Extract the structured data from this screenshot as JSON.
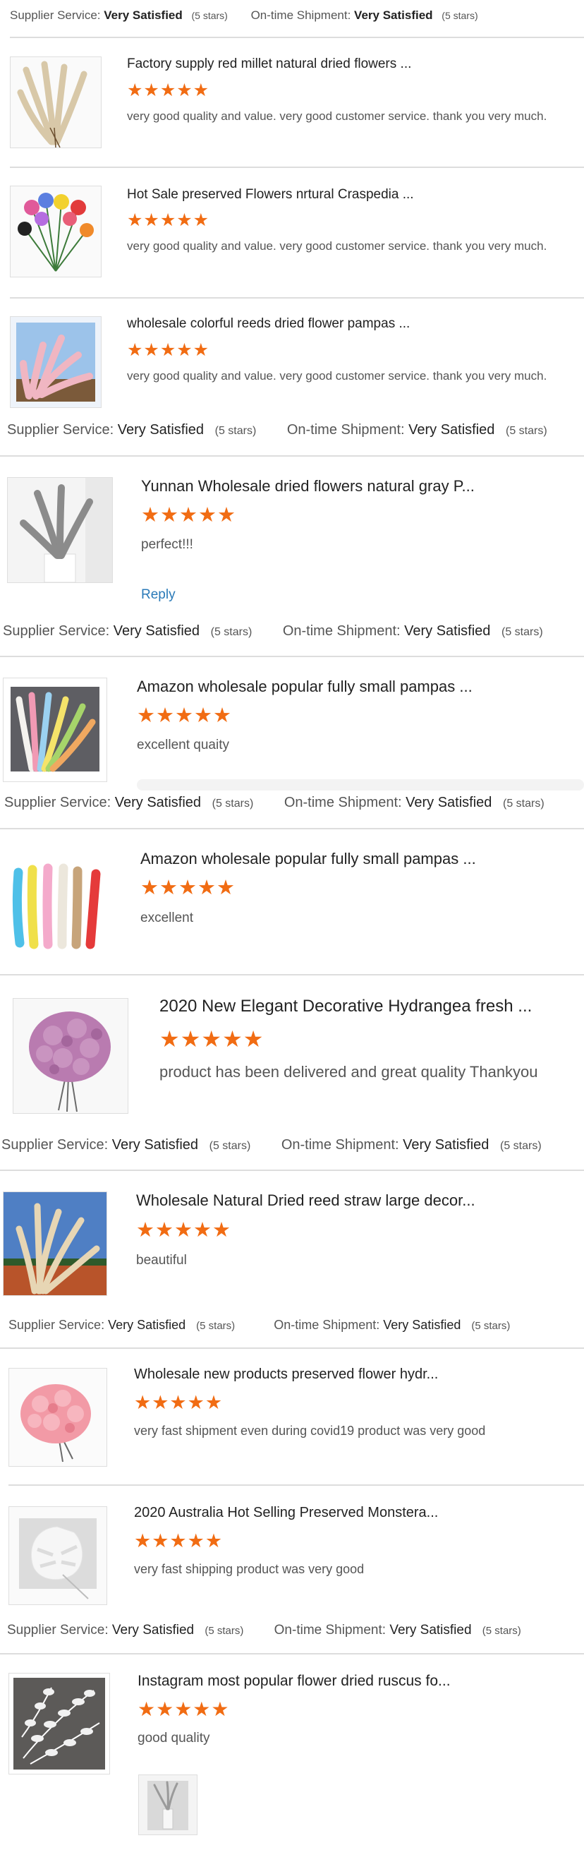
{
  "labels": {
    "supplier_service": "Supplier Service:",
    "ontime_shipment": "On-time Shipment:",
    "very_satisfied": "Very Satisfied",
    "five_stars": "(5 stars)",
    "reply": "Reply"
  },
  "colors": {
    "star": "#f16c13",
    "divider": "#dddddd",
    "link": "#2a7ab8"
  },
  "reviews": [
    {
      "title": "Factory supply red millet natural dried flowers ...",
      "rating": 5,
      "comment": "very good quality and value. very good customer service. thank you very much.",
      "thumb": "pampas-beige"
    },
    {
      "title": "Hot Sale preserved Flowers nrtural Craspedia ...",
      "rating": 5,
      "comment": "very good quality and value. very good customer service. thank you very much.",
      "thumb": "craspedia-balls"
    },
    {
      "title": "wholesale colorful reeds dried flower pampas ...",
      "rating": 5,
      "comment": "very good quality and value. very good customer service. thank you very much.",
      "thumb": "pampas-pink"
    },
    {
      "title": "Yunnan Wholesale dried flowers natural gray P...",
      "rating": 5,
      "comment": "perfect!!!",
      "thumb": "pampas-gray"
    },
    {
      "title": "Amazon wholesale popular fully small pampas ...",
      "rating": 5,
      "comment": "excellent quaity",
      "thumb": "pampas-colorful"
    },
    {
      "title": "Amazon wholesale popular fully small pampas ...",
      "rating": 5,
      "comment": "excellent",
      "thumb": "pampas-rainbow"
    },
    {
      "title": "2020 New Elegant Decorative Hydrangea fresh ...",
      "rating": 5,
      "comment": "product has been delivered and great quality Thankyou",
      "thumb": "hydrangea-purple"
    },
    {
      "title": "Wholesale Natural Dried reed straw large decor...",
      "rating": 5,
      "comment": "beautiful",
      "thumb": "reed-field"
    },
    {
      "title": "Wholesale new products preserved flower hydr...",
      "rating": 5,
      "comment": "very fast shipment even during covid19 product was very good",
      "thumb": "hydrangea-pink"
    },
    {
      "title": "2020 Australia Hot Selling Preserved Monstera...",
      "rating": 5,
      "comment": "very fast shipping product was very good",
      "thumb": "monstera-white"
    },
    {
      "title": "Instagram most popular flower dried ruscus fo...",
      "rating": 5,
      "comment": "good quality",
      "thumb": "ruscus-white"
    }
  ]
}
